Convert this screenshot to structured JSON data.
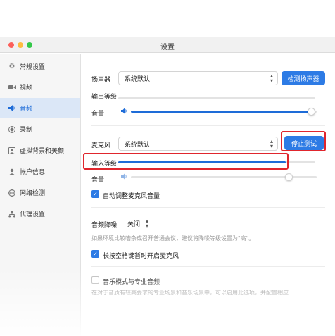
{
  "window": {
    "title": "设置"
  },
  "sidebar": {
    "items": [
      {
        "label": "常规设置",
        "icon": "gear-icon",
        "active": false
      },
      {
        "label": "视频",
        "icon": "video-camera-icon",
        "active": false
      },
      {
        "label": "音频",
        "icon": "speaker-icon",
        "active": true
      },
      {
        "label": "录制",
        "icon": "record-icon",
        "active": false
      },
      {
        "label": "虚拟背景和美颜",
        "icon": "portrait-icon",
        "active": false
      },
      {
        "label": "帐户信息",
        "icon": "account-icon",
        "active": false
      },
      {
        "label": "网络检测",
        "icon": "globe-icon",
        "active": false
      },
      {
        "label": "代理设置",
        "icon": "network-icon",
        "active": false
      }
    ]
  },
  "speaker": {
    "label": "扬声器",
    "device": "系统默认",
    "test_button": "检测扬声器",
    "output_level_label": "输出等级",
    "volume_label": "音量",
    "volume": 0.97
  },
  "microphone": {
    "label": "麦克风",
    "device": "系统默认",
    "stop_test_button": "停止测试",
    "input_level_label": "输入等级",
    "input_level": 0.85,
    "volume_label": "音量",
    "volume": 0.85,
    "auto_adjust_label": "自动调整麦克风音量",
    "auto_adjust_checked": true
  },
  "noise": {
    "label": "音频降噪",
    "value": "关闭",
    "hint": "如果环境比较嘈杂或召开普通会议，建议将降噪等级设置为\"高\"。"
  },
  "push_to_talk": {
    "label": "长按空格键暂时开启麦克风",
    "checked": true
  },
  "music_mode": {
    "label": "音乐模式与专业音频",
    "checked": false,
    "hint": "在对于音质有较高要求的专业场景和音乐场景中，可以启用此选项，并配置相应"
  },
  "colors": {
    "accent": "#2d7be5",
    "highlight_box": "#e0262d",
    "sidebar_active": "#dbe7f7"
  }
}
